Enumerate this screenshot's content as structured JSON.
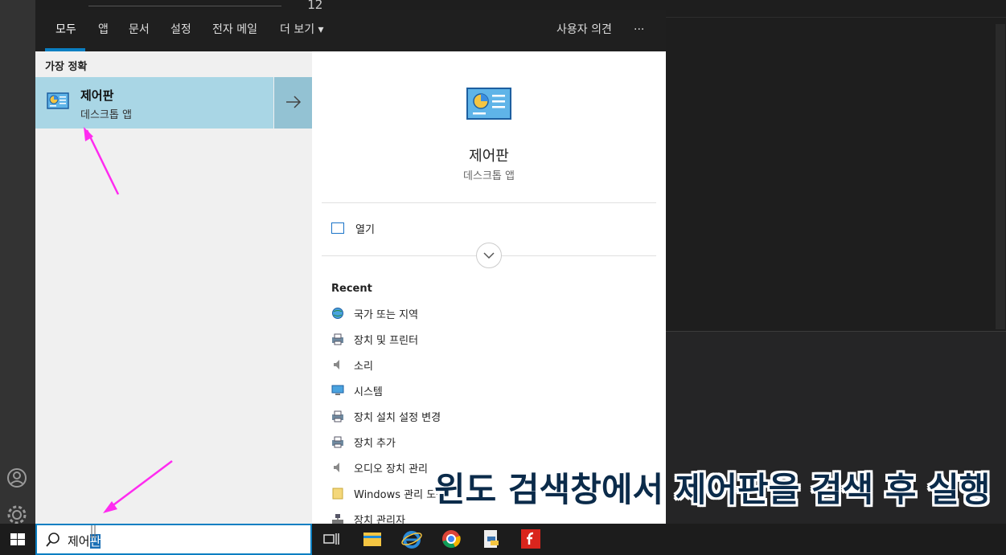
{
  "background": {
    "line_number": "12"
  },
  "tabs": [
    {
      "label": "모두",
      "active": true
    },
    {
      "label": "앱"
    },
    {
      "label": "문서"
    },
    {
      "label": "설정"
    },
    {
      "label": "전자 메일"
    },
    {
      "label": "더 보기 ▾"
    }
  ],
  "header_right": {
    "feedback": "사용자 의견",
    "more": "···"
  },
  "best_match": {
    "section_title": "가장 정확",
    "title": "제어판",
    "subtitle": "데스크톱 앱"
  },
  "detail": {
    "title": "제어판",
    "subtitle": "데스크톱 앱",
    "open_label": "열기",
    "recent_title": "Recent",
    "recent_items": [
      {
        "label": "국가 또는 지역",
        "icon": "globe-icon"
      },
      {
        "label": "장치 및 프린터",
        "icon": "printer-icon"
      },
      {
        "label": "소리",
        "icon": "speaker-icon"
      },
      {
        "label": "시스템",
        "icon": "monitor-icon"
      },
      {
        "label": "장치 설치 설정 변경",
        "icon": "printer-icon"
      },
      {
        "label": "장치 추가",
        "icon": "printer-icon"
      },
      {
        "label": "오디오 장치 관리",
        "icon": "speaker-icon"
      },
      {
        "label": "Windows 관리 도구",
        "icon": "folder-icon"
      },
      {
        "label": "장치 관리자",
        "icon": "device-manager-icon"
      }
    ]
  },
  "search": {
    "typed_prefix": "제어",
    "typed_selected": "판"
  },
  "caption": "윈도 검색창에서 제어판을 검색 후 실행",
  "colors": {
    "accent": "#0a7fc2",
    "best_match_bg": "#a9d6e5",
    "annotation_arrow": "#ff2bf0"
  }
}
